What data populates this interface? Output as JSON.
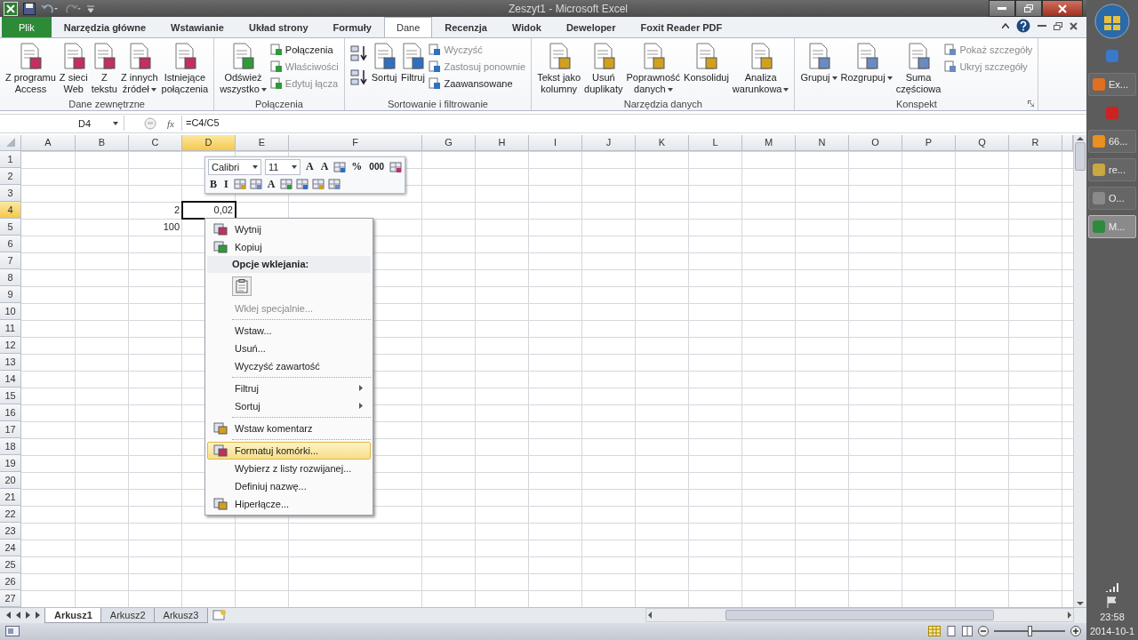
{
  "window": {
    "title": "Zeszyt1 - Microsoft Excel"
  },
  "tabs": [
    {
      "label": "Plik",
      "kind": "file",
      "selected": false
    },
    {
      "label": "Narzędzia główne",
      "kind": "tab",
      "selected": false
    },
    {
      "label": "Wstawianie",
      "kind": "tab",
      "selected": false
    },
    {
      "label": "Układ strony",
      "kind": "tab",
      "selected": false
    },
    {
      "label": "Formuły",
      "kind": "tab",
      "selected": false
    },
    {
      "label": "Dane",
      "kind": "tab",
      "selected": true
    },
    {
      "label": "Recenzja",
      "kind": "tab",
      "selected": false
    },
    {
      "label": "Widok",
      "kind": "tab",
      "selected": false
    },
    {
      "label": "Deweloper",
      "kind": "tab",
      "selected": false
    },
    {
      "label": "Foxit Reader PDF",
      "kind": "tab",
      "selected": false
    }
  ],
  "ribbon": {
    "groups": [
      {
        "label": "Dane zewnętrzne",
        "launcher": false,
        "items": [
          {
            "kind": "large",
            "lines": [
              "Z programu",
              "Access"
            ],
            "dropdown": false
          },
          {
            "kind": "large",
            "lines": [
              "Z sieci",
              "Web"
            ],
            "dropdown": false
          },
          {
            "kind": "large",
            "lines": [
              "Z",
              "tekstu"
            ],
            "dropdown": false
          },
          {
            "kind": "large",
            "lines": [
              "Z innych",
              "źródeł"
            ],
            "dropdown": true
          },
          {
            "kind": "large",
            "lines": [
              "Istniejące",
              "połączenia"
            ],
            "dropdown": false
          }
        ]
      },
      {
        "label": "Połączenia",
        "launcher": false,
        "items": [
          {
            "kind": "large",
            "lines": [
              "Odśwież",
              "wszystko"
            ],
            "dropdown": true
          },
          {
            "kind": "small",
            "label": "Połączenia",
            "disabled": false
          },
          {
            "kind": "small",
            "label": "Właściwości",
            "disabled": true
          },
          {
            "kind": "small",
            "label": "Edytuj łącza",
            "disabled": true
          }
        ]
      },
      {
        "label": "Sortowanie i filtrowanie",
        "launcher": false,
        "items": [
          {
            "kind": "icon"
          },
          {
            "kind": "icon"
          },
          {
            "kind": "large",
            "lines": [
              "Sortuj"
            ],
            "dropdown": false
          },
          {
            "kind": "large",
            "lines": [
              "Filtruj"
            ],
            "dropdown": false
          },
          {
            "kind": "small",
            "label": "Wyczyść",
            "disabled": true
          },
          {
            "kind": "small",
            "label": "Zastosuj ponownie",
            "disabled": true
          },
          {
            "kind": "small",
            "label": "Zaawansowane",
            "disabled": false
          }
        ]
      },
      {
        "label": "Narzędzia danych",
        "launcher": false,
        "items": [
          {
            "kind": "large",
            "lines": [
              "Tekst jako",
              "kolumny"
            ],
            "dropdown": false
          },
          {
            "kind": "large",
            "lines": [
              "Usuń",
              "duplikaty"
            ],
            "dropdown": false
          },
          {
            "kind": "large",
            "lines": [
              "Poprawność",
              "danych"
            ],
            "dropdown": true
          },
          {
            "kind": "large",
            "lines": [
              "Konsoliduj"
            ],
            "dropdown": false
          },
          {
            "kind": "large",
            "lines": [
              "Analiza",
              "warunkowa"
            ],
            "dropdown": true
          }
        ]
      },
      {
        "label": "Konspekt",
        "launcher": true,
        "items": [
          {
            "kind": "large",
            "lines": [
              "Grupuj"
            ],
            "dropdown": true
          },
          {
            "kind": "large",
            "lines": [
              "Rozgrupuj"
            ],
            "dropdown": true
          },
          {
            "kind": "large",
            "lines": [
              "Suma",
              "częściowa"
            ],
            "dropdown": false
          },
          {
            "kind": "small",
            "label": "Pokaż szczegóły",
            "disabled": true
          },
          {
            "kind": "small",
            "label": "Ukryj szczegóły",
            "disabled": true
          }
        ]
      }
    ]
  },
  "formula_bar": {
    "name_box": "D4",
    "fx_label": "fx",
    "formula": "=C4/C5"
  },
  "sheet": {
    "columns": [
      {
        "label": "A",
        "selected": false
      },
      {
        "label": "B",
        "selected": false
      },
      {
        "label": "C",
        "selected": false
      },
      {
        "label": "D",
        "selected": true
      },
      {
        "label": "E",
        "selected": false
      },
      {
        "label": "F",
        "selected": false
      },
      {
        "label": "G",
        "selected": false
      },
      {
        "label": "H",
        "selected": false
      },
      {
        "label": "I",
        "selected": false
      },
      {
        "label": "J",
        "selected": false
      },
      {
        "label": "K",
        "selected": false
      },
      {
        "label": "L",
        "selected": false
      },
      {
        "label": "M",
        "selected": false
      },
      {
        "label": "N",
        "selected": false
      },
      {
        "label": "O",
        "selected": false
      },
      {
        "label": "P",
        "selected": false
      },
      {
        "label": "Q",
        "selected": false
      },
      {
        "label": "R",
        "selected": false
      }
    ],
    "rows": [
      {
        "label": "1",
        "selected": false
      },
      {
        "label": "2",
        "selected": false
      },
      {
        "label": "3",
        "selected": false
      },
      {
        "label": "4",
        "selected": true,
        "cells": [
          null,
          null,
          {
            "text": "2",
            "active": false
          },
          {
            "text": "0,02",
            "active": true
          }
        ]
      },
      {
        "label": "5",
        "selected": false,
        "cells": [
          null,
          null,
          {
            "text": "100",
            "active": false
          }
        ]
      },
      {
        "label": "6",
        "selected": false
      },
      {
        "label": "7",
        "selected": false
      },
      {
        "label": "8",
        "selected": false
      },
      {
        "label": "9",
        "selected": false
      },
      {
        "label": "10",
        "selected": false
      },
      {
        "label": "11",
        "selected": false
      },
      {
        "label": "12",
        "selected": false
      },
      {
        "label": "13",
        "selected": false
      },
      {
        "label": "14",
        "selected": false
      },
      {
        "label": "15",
        "selected": false
      },
      {
        "label": "16",
        "selected": false
      },
      {
        "label": "17",
        "selected": false
      },
      {
        "label": "18",
        "selected": false
      },
      {
        "label": "19",
        "selected": false
      },
      {
        "label": "20",
        "selected": false
      },
      {
        "label": "21",
        "selected": false
      },
      {
        "label": "22",
        "selected": false
      },
      {
        "label": "23",
        "selected": false
      },
      {
        "label": "24",
        "selected": false
      },
      {
        "label": "25",
        "selected": false
      },
      {
        "label": "26",
        "selected": false
      },
      {
        "label": "27",
        "selected": false
      }
    ]
  },
  "mini_toolbar": {
    "font": "Calibri",
    "size": "11",
    "rows": [
      [
        {
          "kind": "glyph",
          "text": "A"
        },
        {
          "kind": "glyph",
          "text": "A"
        },
        {
          "kind": "icon"
        },
        {
          "kind": "glyph",
          "text": "%"
        },
        {
          "kind": "glyph",
          "text": "000"
        },
        {
          "kind": "icon"
        }
      ],
      [
        {
          "kind": "glyph",
          "text": "B"
        },
        {
          "kind": "glyph",
          "text": "I"
        },
        {
          "kind": "icon"
        },
        {
          "kind": "icon"
        },
        {
          "kind": "glyph",
          "text": "A"
        },
        {
          "kind": "icon"
        },
        {
          "kind": "icon"
        },
        {
          "kind": "icon"
        },
        {
          "kind": "icon"
        }
      ]
    ]
  },
  "context_menu": {
    "items": [
      {
        "kind": "item",
        "label": "Wytnij",
        "has_icon": true,
        "disabled": false,
        "submenu": false,
        "selected": false
      },
      {
        "kind": "item",
        "label": "Kopiuj",
        "has_icon": true,
        "disabled": false,
        "submenu": false,
        "selected": false
      },
      {
        "kind": "header",
        "label": "Opcje wklejania:"
      },
      {
        "kind": "paste"
      },
      {
        "kind": "item",
        "label": "Wklej specjalnie...",
        "has_icon": false,
        "disabled": true,
        "submenu": false,
        "selected": false
      },
      {
        "kind": "separator"
      },
      {
        "kind": "item",
        "label": "Wstaw...",
        "has_icon": false,
        "disabled": false,
        "submenu": false,
        "selected": false
      },
      {
        "kind": "item",
        "label": "Usuń...",
        "has_icon": false,
        "disabled": false,
        "submenu": false,
        "selected": false
      },
      {
        "kind": "item",
        "label": "Wyczyść zawartość",
        "has_icon": false,
        "disabled": false,
        "submenu": false,
        "selected": false
      },
      {
        "kind": "separator"
      },
      {
        "kind": "item",
        "label": "Filtruj",
        "has_icon": false,
        "disabled": false,
        "submenu": true,
        "selected": false
      },
      {
        "kind": "item",
        "label": "Sortuj",
        "has_icon": false,
        "disabled": false,
        "submenu": true,
        "selected": false
      },
      {
        "kind": "separator"
      },
      {
        "kind": "item",
        "label": "Wstaw komentarz",
        "has_icon": true,
        "disabled": false,
        "submenu": false,
        "selected": false
      },
      {
        "kind": "separator"
      },
      {
        "kind": "item",
        "label": "Formatuj komórki...",
        "has_icon": true,
        "disabled": false,
        "submenu": false,
        "selected": true
      },
      {
        "kind": "item",
        "label": "Wybierz z listy rozwijanej...",
        "has_icon": false,
        "disabled": false,
        "submenu": false,
        "selected": false
      },
      {
        "kind": "item",
        "label": "Definiuj nazwę...",
        "has_icon": false,
        "disabled": false,
        "submenu": false,
        "selected": false
      },
      {
        "kind": "item",
        "label": "Hiperłącze...",
        "has_icon": true,
        "disabled": false,
        "submenu": false,
        "selected": false
      }
    ]
  },
  "sheets": [
    {
      "label": "Arkusz1",
      "selected": true
    },
    {
      "label": "Arkusz2",
      "selected": false
    },
    {
      "label": "Arkusz3",
      "selected": false
    }
  ],
  "status_bar": {
    "zoom": {
      "level": 0.5
    }
  },
  "taskbar": {
    "items": [
      {
        "kind": "icon",
        "color": "#3a78c8",
        "selected": false
      },
      {
        "kind": "button",
        "label": "Ex...",
        "color": "#e07020",
        "selected": false
      },
      {
        "kind": "icon",
        "color": "#cc2222",
        "selected": false
      },
      {
        "kind": "button",
        "label": "66...",
        "color": "#e89020",
        "selected": false
      },
      {
        "kind": "button",
        "label": "re...",
        "color": "#c8a840",
        "selected": false
      },
      {
        "kind": "button",
        "label": "O...",
        "color": "#8a8a8a",
        "selected": false
      },
      {
        "kind": "button",
        "label": "M...",
        "color": "#2e8b3e",
        "selected": true
      }
    ],
    "time": "23:58",
    "date": "2014-10-1"
  }
}
